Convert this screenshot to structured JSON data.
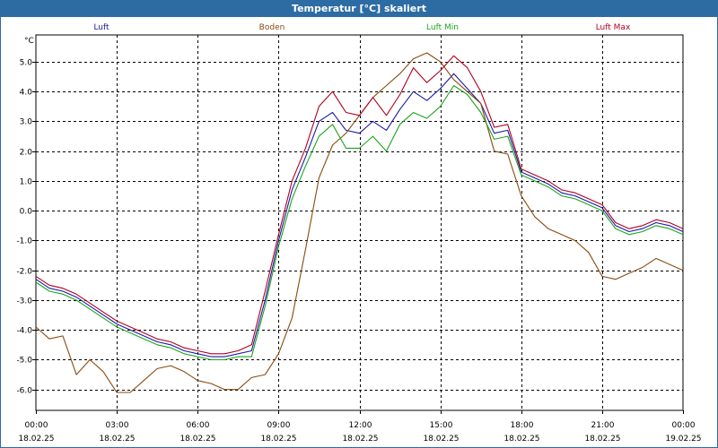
{
  "window": {
    "title": "Temperatur [°C] skaliert"
  },
  "chart_data": {
    "type": "line",
    "title": "Temperatur [°C] skaliert",
    "ylabel": "°C",
    "ylim": [
      -6.7,
      5.9
    ],
    "grid": true,
    "legend_placement": "top",
    "yticks": [
      "5.0",
      "4.0",
      "3.0",
      "2.0",
      "1.0",
      "0.0",
      "-1.0",
      "-2.0",
      "-3.0",
      "-4.0",
      "-5.0",
      "-6.0"
    ],
    "xticks": [
      {
        "time": "00:00",
        "date": "18.02.25"
      },
      {
        "time": "03:00",
        "date": "18.02.25"
      },
      {
        "time": "06:00",
        "date": "18.02.25"
      },
      {
        "time": "09:00",
        "date": "18.02.25"
      },
      {
        "time": "12:00",
        "date": "18.02.25"
      },
      {
        "time": "15:00",
        "date": "18.02.25"
      },
      {
        "time": "18:00",
        "date": "18.02.25"
      },
      {
        "time": "21:00",
        "date": "18.02.25"
      },
      {
        "time": "00:00",
        "date": "19.02.25"
      }
    ],
    "x_hours": [
      0,
      0.5,
      1,
      1.5,
      2,
      2.5,
      3,
      3.5,
      4,
      4.5,
      5,
      5.5,
      6,
      6.5,
      7,
      7.5,
      8,
      8.5,
      9,
      9.5,
      10,
      10.5,
      11,
      11.5,
      12,
      12.5,
      13,
      13.5,
      14,
      14.5,
      15,
      15.5,
      16,
      16.5,
      17,
      17.5,
      18,
      18.5,
      19,
      19.5,
      20,
      20.5,
      21,
      21.5,
      22,
      22.5,
      23,
      23.5,
      24
    ],
    "series": [
      {
        "name": "Luft",
        "color": "#1a1aa6",
        "values": [
          -2.3,
          -2.6,
          -2.7,
          -2.9,
          -3.2,
          -3.5,
          -3.8,
          -4.0,
          -4.2,
          -4.4,
          -4.5,
          -4.7,
          -4.8,
          -4.9,
          -4.9,
          -4.8,
          -4.7,
          -3.0,
          -1.0,
          0.7,
          1.8,
          3.0,
          3.3,
          2.7,
          2.6,
          3.0,
          2.7,
          3.4,
          4.0,
          3.7,
          4.1,
          4.6,
          4.1,
          3.6,
          2.6,
          2.7,
          1.3,
          1.1,
          0.9,
          0.6,
          0.5,
          0.3,
          0.1,
          -0.5,
          -0.7,
          -0.6,
          -0.4,
          -0.5,
          -0.7
        ]
      },
      {
        "name": "Boden",
        "color": "#8b4a0e",
        "values": [
          -3.9,
          -4.3,
          -4.2,
          -5.5,
          -5.0,
          -5.4,
          -6.1,
          -6.1,
          -5.7,
          -5.3,
          -5.2,
          -5.4,
          -5.7,
          -5.8,
          -6.0,
          -6.0,
          -5.6,
          -5.5,
          -4.8,
          -3.6,
          -1.3,
          1.1,
          2.2,
          2.6,
          3.2,
          3.8,
          4.2,
          4.6,
          5.1,
          5.3,
          5.0,
          4.4,
          4.0,
          3.6,
          2.0,
          1.9,
          0.5,
          -0.2,
          -0.6,
          -0.8,
          -1.0,
          -1.4,
          -2.2,
          -2.3,
          -2.1,
          -1.9,
          -1.6,
          -1.8,
          -2.0
        ]
      },
      {
        "name": "Luft Min",
        "color": "#1ca51c",
        "values": [
          -2.4,
          -2.7,
          -2.8,
          -3.0,
          -3.3,
          -3.6,
          -3.9,
          -4.1,
          -4.3,
          -4.5,
          -4.6,
          -4.8,
          -4.9,
          -5.0,
          -5.0,
          -4.9,
          -4.9,
          -3.2,
          -1.2,
          0.4,
          1.5,
          2.5,
          2.9,
          2.1,
          2.1,
          2.5,
          2.0,
          2.9,
          3.3,
          3.1,
          3.5,
          4.2,
          3.9,
          3.3,
          2.4,
          2.5,
          1.2,
          1.0,
          0.8,
          0.5,
          0.4,
          0.2,
          0.0,
          -0.6,
          -0.8,
          -0.7,
          -0.5,
          -0.6,
          -0.8
        ]
      },
      {
        "name": "Luft Max",
        "color": "#b00020",
        "values": [
          -2.2,
          -2.5,
          -2.6,
          -2.8,
          -3.1,
          -3.4,
          -3.7,
          -3.9,
          -4.1,
          -4.3,
          -4.4,
          -4.6,
          -4.7,
          -4.8,
          -4.8,
          -4.7,
          -4.5,
          -2.7,
          -0.8,
          1.0,
          2.1,
          3.5,
          4.0,
          3.3,
          3.2,
          3.8,
          3.2,
          3.9,
          4.8,
          4.3,
          4.7,
          5.2,
          4.8,
          4.0,
          2.8,
          2.9,
          1.4,
          1.2,
          1.0,
          0.7,
          0.6,
          0.4,
          0.2,
          -0.4,
          -0.6,
          -0.5,
          -0.3,
          -0.4,
          -0.6
        ]
      }
    ]
  }
}
